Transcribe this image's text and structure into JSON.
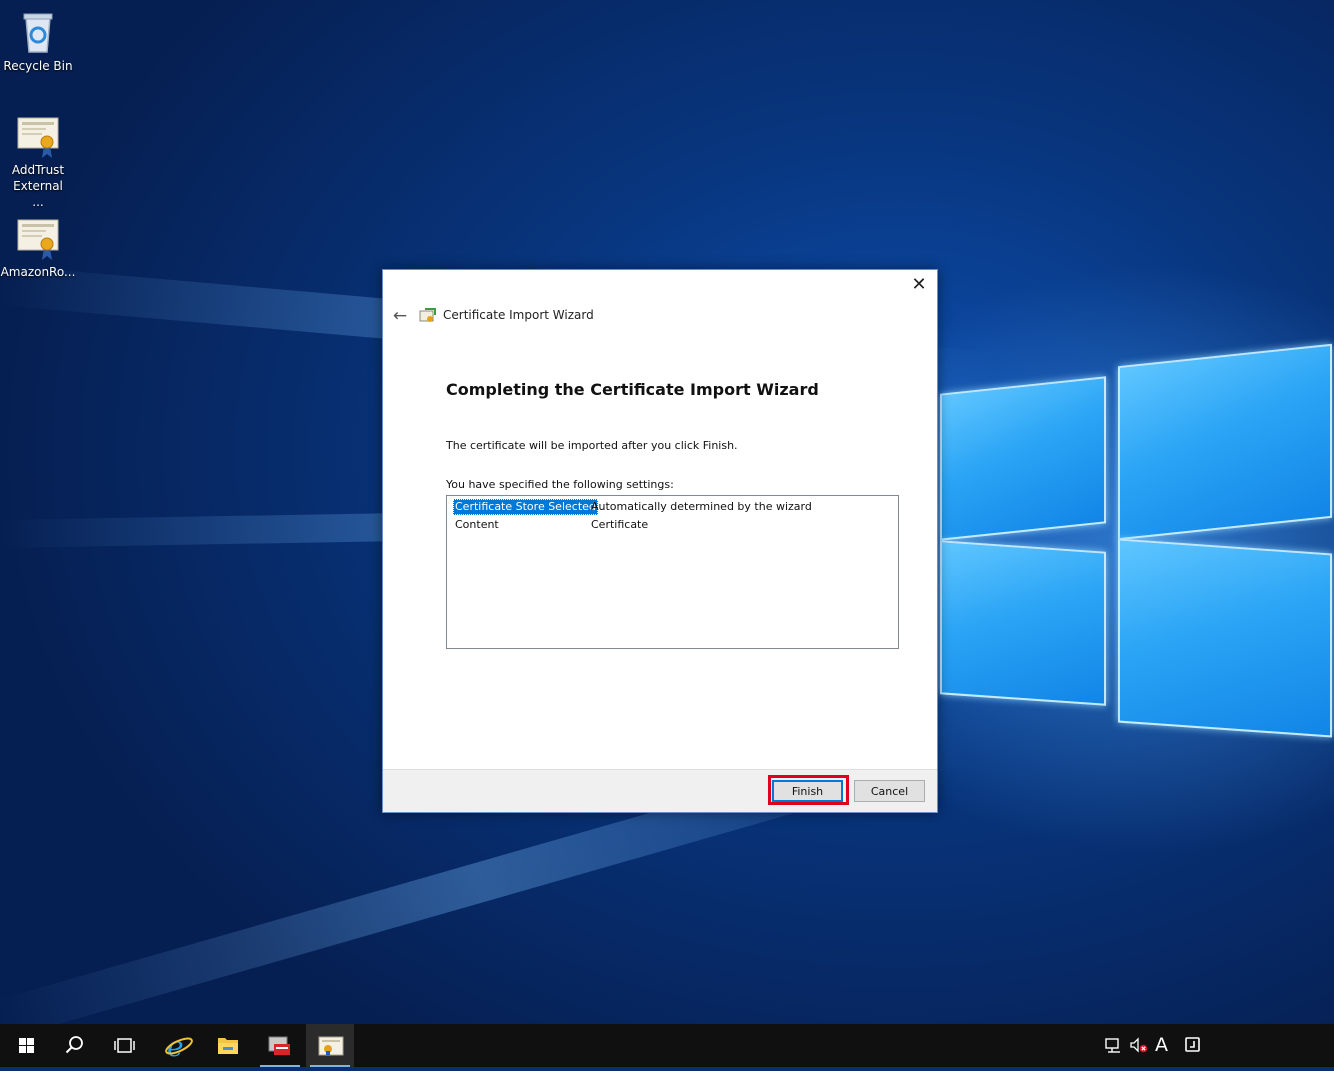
{
  "desktop": {
    "icons": [
      {
        "label": "Recycle Bin",
        "icon": "recycle-bin-icon"
      },
      {
        "label": "AddTrust External ...",
        "icon": "certificate-icon"
      },
      {
        "label": "AmazonRo...",
        "icon": "certificate-icon"
      }
    ]
  },
  "dialog": {
    "title": "Certificate Import Wizard",
    "close_glyph": "✕",
    "back_glyph": "←",
    "heading": "Completing the Certificate Import Wizard",
    "intro": "The certificate will be imported after you click Finish.",
    "settings_label": "You have specified the following settings:",
    "settings": [
      {
        "key": "Certificate Store Selected",
        "value": "Automatically determined by the wizard"
      },
      {
        "key": "Content",
        "value": "Certificate"
      }
    ],
    "finish_label": "Finish",
    "cancel_label": "Cancel"
  },
  "taskbar": {
    "items": [
      "start-icon",
      "search-icon",
      "task-view-icon",
      "internet-explorer-icon",
      "file-explorer-icon",
      "server-manager-icon",
      "certificate-app-icon"
    ],
    "tray": [
      "network-icon",
      "volume-muted-icon",
      "ime-a-icon",
      "notification-icon"
    ],
    "ime_label": "A"
  },
  "colors": {
    "accent": "#0078d7",
    "highlight_box": "#e0001b"
  }
}
